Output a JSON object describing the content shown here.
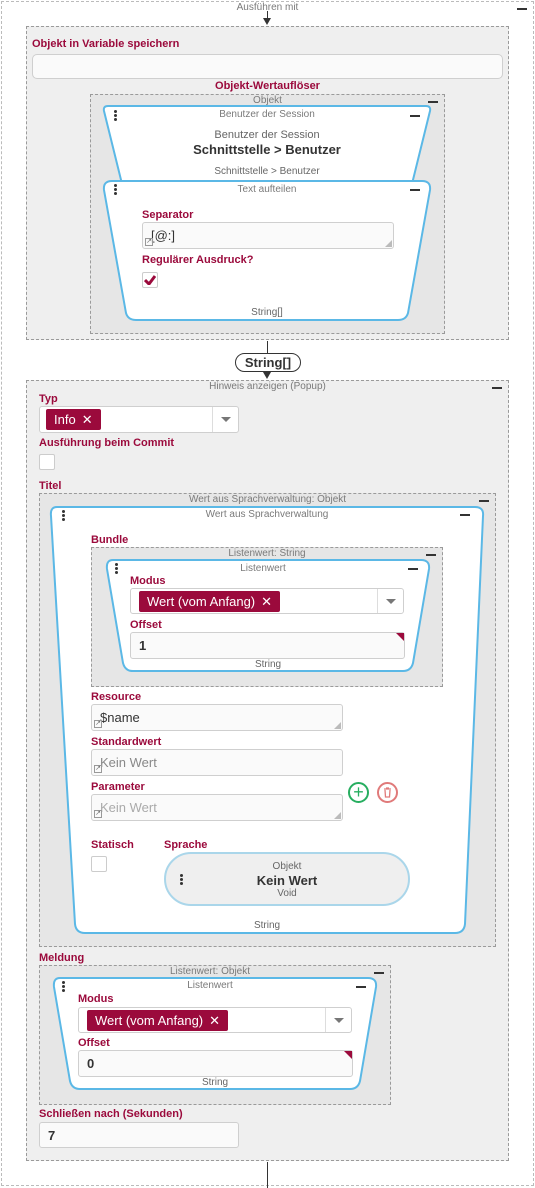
{
  "outer": {
    "caption": "Ausführen mit"
  },
  "store_var": {
    "label": "Objekt in Variable speichern",
    "value": ""
  },
  "resolver": {
    "title": "Objekt-Wertauflöser",
    "object_caption": "Objekt",
    "session_node": {
      "caption": "Benutzer der Session",
      "subtitle": "Benutzer der Session",
      "main": "Schnittstelle > Benutzer",
      "footer": "Schnittstelle > Benutzer"
    },
    "split_node": {
      "caption": "Text aufteilen",
      "separator_label": "Separator",
      "separator_value": "[@:]",
      "regex_label": "Regulärer Ausdruck?",
      "regex_checked": true,
      "footer": "String[]"
    }
  },
  "connector": {
    "label": "String[]"
  },
  "popup": {
    "caption": "Hinweis anzeigen (Popup)",
    "typ_label": "Typ",
    "typ_chip": "Info",
    "commit_label": "Ausführung beim Commit",
    "titel_label": "Titel",
    "titel_outer_caption": "Wert aus Sprachverwaltung: Objekt",
    "titel_inner_caption": "Wert aus Sprachverwaltung",
    "bundle_label": "Bundle",
    "bundle_outer_caption": "Listenwert: String",
    "bundle_inner_caption": "Listenwert",
    "bundle_modus_label": "Modus",
    "bundle_modus_chip": "Wert (vom Anfang)",
    "bundle_offset_label": "Offset",
    "bundle_offset_value": "1",
    "bundle_footer": "String",
    "resource_label": "Resource",
    "resource_value": "$name",
    "default_label": "Standardwert",
    "default_placeholder": "Kein Wert",
    "param_label": "Parameter",
    "param_placeholder": "Kein Wert",
    "static_label": "Statisch",
    "lang_label": "Sprache",
    "lang_node_caption": "Objekt",
    "lang_node_value": "Kein Wert",
    "lang_node_type": "Void",
    "titel_footer": "String",
    "meldung_label": "Meldung",
    "meldung_outer_caption": "Listenwert: Objekt",
    "meldung_inner_caption": "Listenwert",
    "meldung_modus_label": "Modus",
    "meldung_modus_chip": "Wert (vom Anfang)",
    "meldung_offset_label": "Offset",
    "meldung_offset_value": "0",
    "meldung_footer": "String",
    "close_label": "Schließen nach (Sekunden)",
    "close_value": "7"
  },
  "colors": {
    "accent": "#9b0a3c",
    "node_border": "#5bb8e6",
    "add": "#27ae60",
    "delete": "#e07a7a"
  }
}
